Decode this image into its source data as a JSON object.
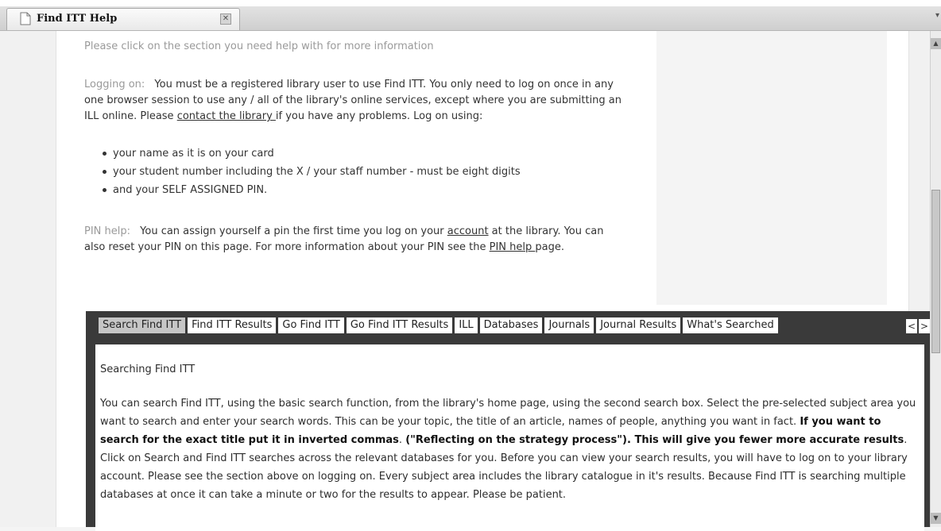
{
  "tab": {
    "title": "Find ITT Help",
    "close_symbol": "✕",
    "menu_symbol": "▾"
  },
  "intro": "Please click on the section you need help with for more information",
  "logging": {
    "label": "Logging on:",
    "text_before_link": "You must be a registered library user to use Find ITT. You only need to log on once in any one browser session to use any / all of the library's online services, except where you are submitting an ILL online. Please ",
    "link": "contact the library ",
    "text_after_link": "if you have any problems. Log on using:",
    "bullets": [
      "your name as it is on your card",
      "your student number including the X / your staff number - must be eight digits",
      "and your SELF ASSIGNED PIN."
    ]
  },
  "pin": {
    "label": "PIN help:",
    "text1": "You can assign yourself a pin the first time you log on your ",
    "link1": "account",
    "text2": " at the library. You can also reset your PIN on this page. For more information about your PIN see the ",
    "link2": "PIN help ",
    "text3": "page."
  },
  "help_tabs": [
    "Search Find ITT",
    "Find ITT Results",
    "Go Find ITT",
    "Go Find ITT Results",
    "ILL",
    "Databases",
    "Journals",
    "Journal Results",
    "What's Searched"
  ],
  "active_help_tab": "Search Find ITT",
  "arrows": {
    "prev": "<",
    "next": ">"
  },
  "content": {
    "heading": "Searching Find ITT",
    "p1": "You can search Find ITT, using the basic search function, from the library's home page, using the second search box. Select the pre-selected subject area you want to search and enter your search words. This can be your topic, the title of an article, names of people, anything you want in fact. ",
    "b1": "If you want to search for the exact title put it in inverted commas",
    "p2": ". ",
    "b2": "(\"Reflecting on the strategy process\"). This will give you fewer more accurate results",
    "p3": ". Click on Search and Find ITT searches across the relevant databases for you. Before you can view your search results, you will have to log on to your library account. Please see the section above on logging on. Every subject area includes the library catalogue in it's results. Because Find ITT is searching multiple databases at once it can take a minute or two for the results to appear. Please be patient."
  },
  "scrollbar": {
    "up": "▲",
    "down": "▼"
  },
  "colors": {
    "dark_panel": "#3a3a3a",
    "active_tab": "#c6c6c6",
    "muted_label": "#9a9a9a"
  }
}
